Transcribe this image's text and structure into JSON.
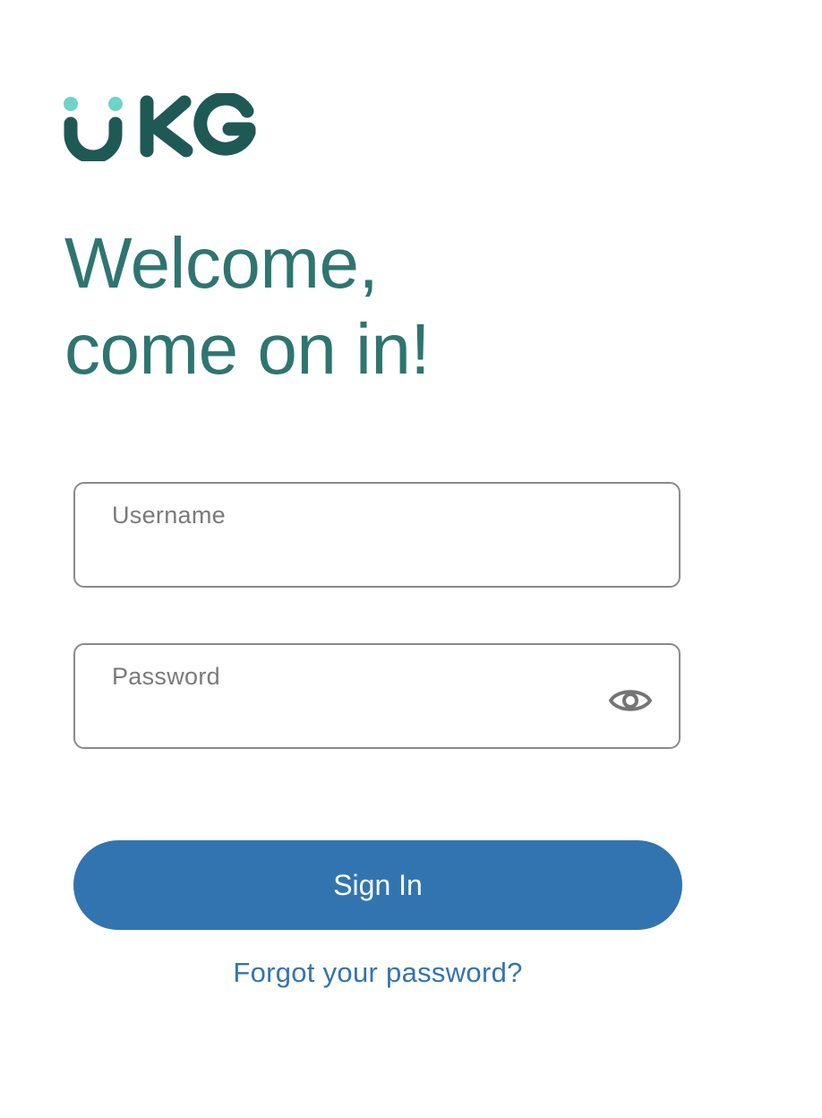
{
  "brand": {
    "logo_text": "UKG",
    "logo_primary_color": "#1f5956",
    "logo_accent_color": "#6fd3c7"
  },
  "heading": {
    "line1": "Welcome,",
    "line2": "come on in!",
    "color": "#2e7571"
  },
  "form": {
    "username": {
      "label": "Username",
      "value": ""
    },
    "password": {
      "label": "Password",
      "value": "",
      "toggle_icon": "eye-icon"
    },
    "signin_label": "Sign In",
    "signin_color": "#3274b0",
    "forgot_label": "Forgot your password?"
  }
}
